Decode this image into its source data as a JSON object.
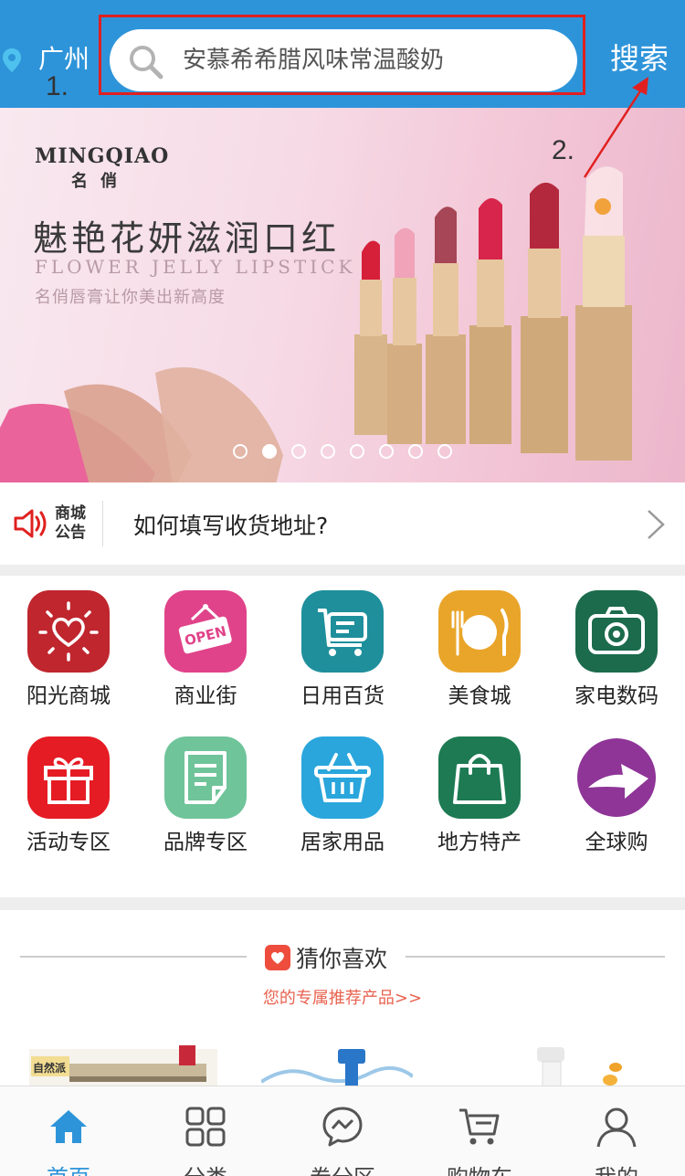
{
  "header": {
    "location": "广州",
    "search_placeholder": "安慕希希腊风味常温酸奶",
    "search_button": "搜索",
    "annotation_1": "1.",
    "annotation_2": "2."
  },
  "banner": {
    "brand": "MINGQIAO",
    "brand_cn": "名俏",
    "title": "魅艳花妍滋润口红",
    "title_en": "FLOWER JELLY LIPSTICK",
    "subtitle": "名俏唇膏让你美出新高度",
    "slide_count": 8,
    "active_slide": 2
  },
  "notice": {
    "tag_line1": "商城",
    "tag_line2": "公告",
    "text": "如何填写收货地址?"
  },
  "categories": [
    {
      "label": "阳光商城",
      "icon": "sun-heart-icon",
      "color": "#c0262e"
    },
    {
      "label": "商业街",
      "icon": "open-sign-icon",
      "color": "#e0438a"
    },
    {
      "label": "日用百货",
      "icon": "cart-icon",
      "color": "#1f8f9c"
    },
    {
      "label": "美食城",
      "icon": "plate-cutlery-icon",
      "color": "#e9a52a"
    },
    {
      "label": "家电数码",
      "icon": "camera-icon",
      "color": "#1b6b4c"
    },
    {
      "label": "活动专区",
      "icon": "gift-icon",
      "color": "#e51c24"
    },
    {
      "label": "品牌专区",
      "icon": "document-icon",
      "color": "#6fc49a"
    },
    {
      "label": "居家用品",
      "icon": "basket-icon",
      "color": "#2aa6dc"
    },
    {
      "label": "地方特产",
      "icon": "shopping-bag-icon",
      "color": "#1d7a52"
    },
    {
      "label": "全球购",
      "icon": "global-arrow-icon",
      "color": "#8e3597"
    }
  ],
  "recommend": {
    "title": "猜你喜欢",
    "subtitle": "您的专属推荐产品>>",
    "product_tag": "自然派"
  },
  "tabbar": [
    {
      "label": "首页",
      "icon": "home-icon",
      "active": true
    },
    {
      "label": "分类",
      "icon": "grid-icon",
      "active": false
    },
    {
      "label": "券分区",
      "icon": "chat-bubble-icon",
      "active": false
    },
    {
      "label": "购物车",
      "icon": "cart-icon",
      "active": false
    },
    {
      "label": "我的",
      "icon": "user-icon",
      "active": false
    }
  ]
}
